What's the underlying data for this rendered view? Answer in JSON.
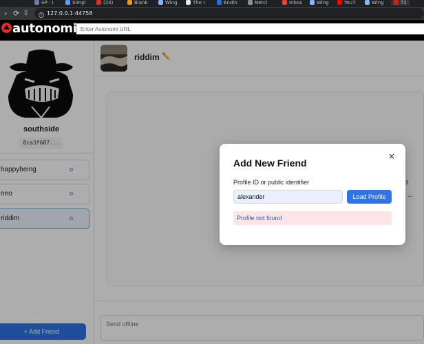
{
  "browser": {
    "tabs": [
      {
        "label": "SP ⋅ i",
        "color": "#6f7dad"
      },
      {
        "label": "Simpl",
        "color": "#5ba4f5"
      },
      {
        "label": "(24)",
        "color": "#d93025"
      },
      {
        "label": "Blank",
        "color": "#f29900"
      },
      {
        "label": "Wing",
        "color": "#8ab4f8"
      },
      {
        "label": "The I",
        "color": "#e8eaed"
      },
      {
        "label": "Endin",
        "color": "#1a73e8"
      },
      {
        "label": "Netcl",
        "color": "#8e9193"
      },
      {
        "label": "Inbox",
        "color": "#ea4335"
      },
      {
        "label": "Wing",
        "color": "#8ab4f8"
      },
      {
        "label": "YouT",
        "color": "#ff0000"
      },
      {
        "label": "Wing",
        "color": "#8ab4f8"
      },
      {
        "label": "T2",
        "color": "#c5221f"
      }
    ],
    "address": "127.0.0.1:44758"
  },
  "autonomi": {
    "brand": "autonomi",
    "url_placeholder": "Enter Autonomi URL",
    "accent": "#e52d27"
  },
  "sidebar": {
    "username": "southside",
    "user_id": "8ca3f687...",
    "friends": [
      {
        "name": "happybeing",
        "active": false
      },
      {
        "name": "neo",
        "active": false
      },
      {
        "name": "riddim",
        "active": true
      }
    ],
    "add_friend_label": "+ Add Friend"
  },
  "chat": {
    "name": "riddim",
    "edit_icon": "✏️",
    "hint_line1": "ent",
    "hint_line2": "...",
    "compose_placeholder": "Send offline"
  },
  "modal": {
    "title": "Add New Friend",
    "close_label": "×",
    "field_label": "Profile ID or public identifier",
    "field_value": "alexander",
    "button_label": "Load Profile",
    "error_text": "Profile not found"
  }
}
